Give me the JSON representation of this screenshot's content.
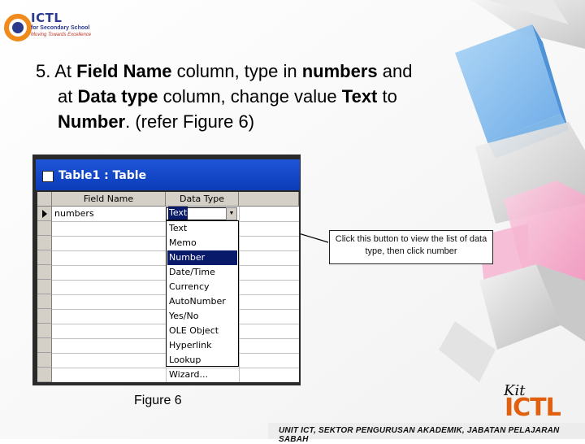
{
  "logo": {
    "name": "ICTL",
    "subtitle": "for Secondary School",
    "tagline": "Moving Towards Excellence",
    "colors": {
      "blue": "#2a3a8c",
      "red": "#c0392b",
      "orange": "#f08a1a"
    }
  },
  "instruction": {
    "line1_a": "5. At ",
    "line1_b": "Field Name",
    "line1_c": " column, type in ",
    "line1_d": "numbers",
    "line1_e": " and",
    "line2_a": "at ",
    "line2_b": "Data type",
    "line2_c": " column, change value ",
    "line2_d": "Text",
    "line2_e": "  to",
    "line3_a": "Number",
    "line3_b": ". (refer Figure 6)"
  },
  "window": {
    "title": "Table1 : Table",
    "title_icon": "table-icon",
    "columns": [
      "Field Name",
      "Data Type"
    ],
    "rows": [
      {
        "field_name": "numbers",
        "data_type": "Text"
      }
    ],
    "current_row_icon": "row-pointer-icon"
  },
  "dropdown": {
    "current_value": "Text",
    "button_icon": "dropdown-arrow-icon",
    "options": [
      "Text",
      "Memo",
      "Number",
      "Date/Time",
      "Currency",
      "AutoNumber",
      "Yes/No",
      "OLE Object",
      "Hyperlink",
      "Lookup Wizard..."
    ],
    "selected_option": "Number"
  },
  "callout": {
    "text": "Click this button to view the list of data type, then click number"
  },
  "caption": "Figure 6",
  "footer": {
    "text": "UNIT ICT, SEKTOR PENGURUSAN AKADEMIK, JABATAN PELAJARAN SABAH",
    "logo_top": "Kit",
    "logo_main": "ICTL",
    "logo_color": "#e06010"
  }
}
